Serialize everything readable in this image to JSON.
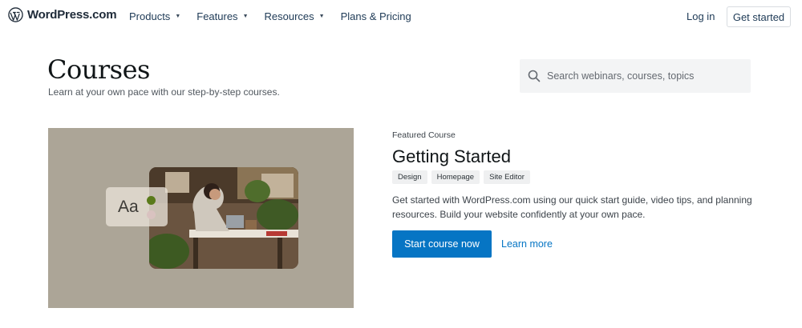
{
  "header": {
    "logo_text": "WordPress.com",
    "nav": [
      {
        "label": "Products",
        "has_dropdown": true
      },
      {
        "label": "Features",
        "has_dropdown": true
      },
      {
        "label": "Resources",
        "has_dropdown": true
      },
      {
        "label": "Plans & Pricing",
        "has_dropdown": false
      }
    ],
    "login_label": "Log in",
    "get_started_label": "Get started",
    "caret_glyph": "▼"
  },
  "page": {
    "title": "Courses",
    "subtitle": "Learn at your own pace with our step-by-step courses."
  },
  "search": {
    "placeholder": "Search webinars, courses, topics",
    "icon": "search-icon"
  },
  "featured": {
    "kicker": "Featured Course",
    "title": "Getting Started",
    "tags": [
      "Design",
      "Homepage",
      "Site Editor"
    ],
    "description": "Get started with WordPress.com using our quick start guide, video tips, and planning resources. Build your website confidently at your own pace.",
    "primary_button": "Start course now",
    "secondary_link": "Learn more",
    "type_card_label": "Aa"
  },
  "colors": {
    "accent": "#0675c4",
    "image_background": "#aca597",
    "nav_text": "#1e3a56"
  }
}
